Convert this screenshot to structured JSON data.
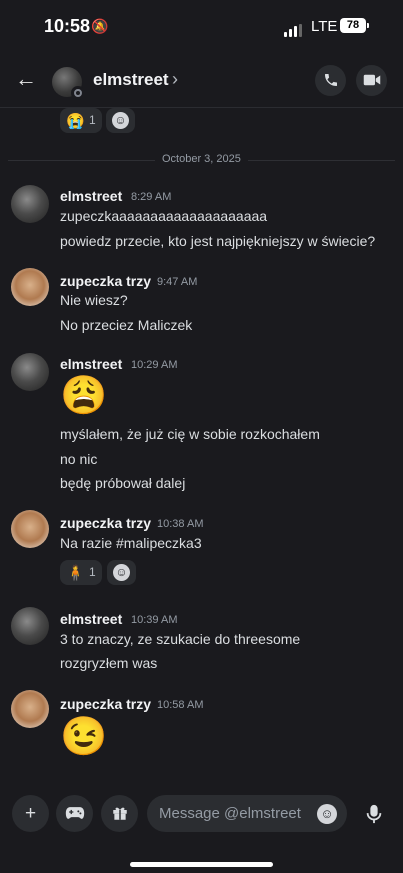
{
  "status_bar": {
    "time": "10:58",
    "network": "LTE",
    "battery": "78"
  },
  "header": {
    "contact_name": "elmstreet",
    "chevron": "›",
    "back_icon": "←"
  },
  "top_reactions": [
    {
      "emoji": "😭",
      "count": "1"
    }
  ],
  "date_divider": "October 3, 2025",
  "messages": [
    {
      "author": "elmstreet",
      "time": "8:29 AM",
      "lines": [
        "zupeczkaaaaaaaaaaaaaaaaaaaa",
        "powiedz przecie, kto jest najpiękniejszy w świecie?"
      ]
    },
    {
      "author": "zupeczka trzy",
      "time": "9:47 AM",
      "lines": [
        "Nie wiesz?",
        "No przeciez Maliczek"
      ]
    },
    {
      "author": "elmstreet",
      "time": "10:29 AM",
      "emoji": "😩",
      "lines": [
        "myślałem, że już cię w sobie rozkochałem",
        "no nic",
        "będę próbował dalej"
      ]
    },
    {
      "author": "zupeczka trzy",
      "time": "10:38 AM",
      "lines": [
        "Na razie #malipeczka3"
      ],
      "reaction": {
        "emoji": "🧍",
        "count": "1"
      }
    },
    {
      "author": "elmstreet",
      "time": "10:39 AM",
      "lines": [
        "3 to znaczy, ze szukacie do threesome",
        "rozgryzłem was"
      ]
    },
    {
      "author": "zupeczka trzy",
      "time": "10:58 AM",
      "emoji": "😉"
    }
  ],
  "composer": {
    "placeholder": "Message @elmstreet",
    "value": ""
  },
  "icons": [
    "arrow-left-icon",
    "phone-icon",
    "video-camera-icon",
    "plus-icon",
    "gamepad-icon",
    "gift-icon",
    "emoji-icon",
    "microphone-icon",
    "add-reaction-icon"
  ]
}
